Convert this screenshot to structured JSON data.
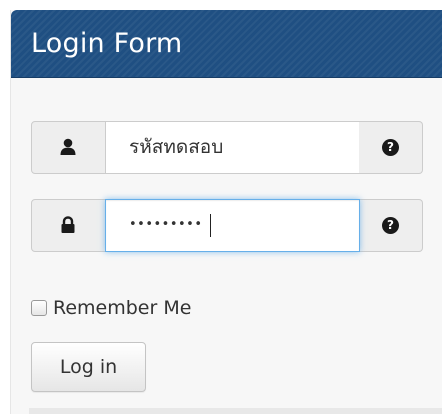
{
  "panel": {
    "title": "Login Form",
    "header_color": "#1f4f82"
  },
  "username": {
    "icon": "user-icon",
    "value": "รหัสทดสอบ",
    "help_icon": "question-circle-icon"
  },
  "password": {
    "icon": "lock-icon",
    "masked_value": "•••••••••",
    "focused": true,
    "focus_color": "#66afe9",
    "help_icon": "question-circle-icon"
  },
  "remember": {
    "label": "Remember Me",
    "checked": false
  },
  "login_button": {
    "label": "Log in"
  }
}
